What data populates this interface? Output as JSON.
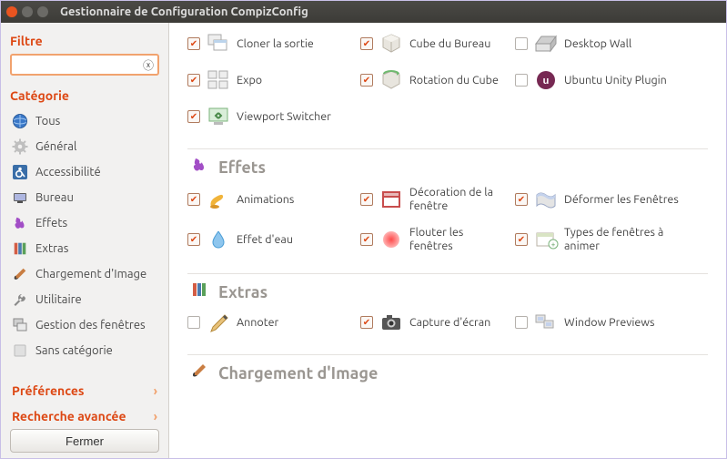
{
  "window": {
    "title": "Gestionnaire de Configuration CompizConfig"
  },
  "sidebar": {
    "filter_head": "Filtre",
    "filter_value": "",
    "category_head": "Catégorie",
    "items": [
      {
        "label": "Tous",
        "icon": "globe"
      },
      {
        "label": "Général",
        "icon": "gear"
      },
      {
        "label": "Accessibilité",
        "icon": "access"
      },
      {
        "label": "Bureau",
        "icon": "desk"
      },
      {
        "label": "Effets",
        "icon": "fire"
      },
      {
        "label": "Extras",
        "icon": "books"
      },
      {
        "label": "Chargement d'Image",
        "icon": "brush"
      },
      {
        "label": "Utilitaire",
        "icon": "wrench"
      },
      {
        "label": "Gestion des fenêtres",
        "icon": "winmgr"
      },
      {
        "label": "Sans catégorie",
        "icon": "blank"
      }
    ],
    "prefs": "Préférences",
    "advanced": "Recherche avancée",
    "close": "Fermer"
  },
  "sections": [
    {
      "title": "",
      "icon": "",
      "show_head": false,
      "plugins": [
        {
          "label": "Cloner la sortie",
          "checked": true,
          "icon": "clone"
        },
        {
          "label": "Cube du Bureau",
          "checked": true,
          "icon": "cube"
        },
        {
          "label": "Desktop Wall",
          "checked": false,
          "icon": "wall"
        },
        {
          "label": "Expo",
          "checked": true,
          "icon": "expo"
        },
        {
          "label": "Rotation du Cube",
          "checked": true,
          "icon": "rotate"
        },
        {
          "label": "Ubuntu Unity Plugin",
          "checked": false,
          "icon": "unity"
        },
        {
          "label": "Viewport Switcher",
          "checked": true,
          "icon": "viewport"
        }
      ]
    },
    {
      "title": "Effets",
      "icon": "fire",
      "show_head": true,
      "plugins": [
        {
          "label": "Animations",
          "checked": true,
          "icon": "lamp"
        },
        {
          "label": "Décoration de la fenêtre",
          "checked": true,
          "icon": "decor"
        },
        {
          "label": "Déformer les Fenêtres",
          "checked": true,
          "icon": "wobble"
        },
        {
          "label": "Effet d'eau",
          "checked": true,
          "icon": "water"
        },
        {
          "label": "Flouter les fenêtres",
          "checked": true,
          "icon": "blur"
        },
        {
          "label": "Types de fenêtres à animer",
          "checked": true,
          "icon": "addon"
        }
      ]
    },
    {
      "title": "Extras",
      "icon": "books",
      "show_head": true,
      "plugins": [
        {
          "label": "Annoter",
          "checked": false,
          "icon": "pencil"
        },
        {
          "label": "Capture d'écran",
          "checked": true,
          "icon": "camera"
        },
        {
          "label": "Window Previews",
          "checked": false,
          "icon": "preview"
        }
      ]
    },
    {
      "title": "Chargement d'Image",
      "icon": "brush",
      "show_head": true,
      "plugins": []
    }
  ]
}
